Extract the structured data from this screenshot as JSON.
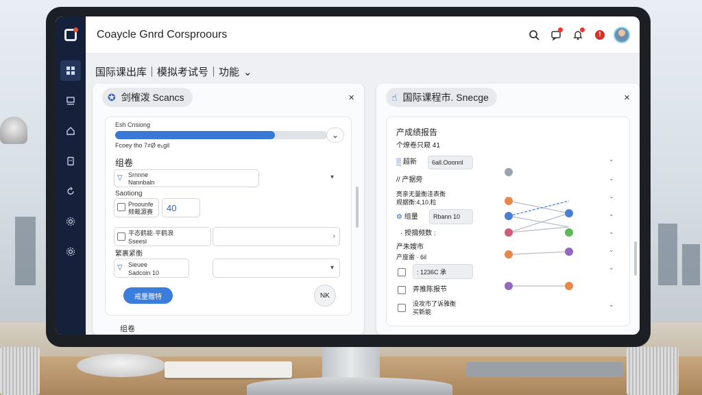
{
  "app": {
    "title": "Coaycle Gnrd Corsproours"
  },
  "breadcrumb": {
    "text": "国际课出库｜模拟考试号｜功能",
    "chevron": "⌄"
  },
  "sidebar_icons": [
    "grid-icon",
    "layers-icon",
    "home-icon",
    "document-icon",
    "refresh-icon",
    "settings-icon",
    "gear-icon"
  ],
  "left_panel": {
    "chip_label": "剑榷泼 Scancs",
    "close": "×",
    "progress": {
      "label": "Esh Cnsiong",
      "sublabel": "Fcoey tho 7≠Ø e₆gil",
      "percent": 75
    },
    "section_title": "组卷",
    "fields": [
      {
        "label_a": "Srnnne",
        "label_b": "Nannbaln"
      },
      {
        "heading": "Saotiong",
        "label_a": "Proounfe",
        "label_b": "频裁源赛",
        "value": "40"
      },
      {
        "label_a": "平态鹤能·平鹤浪",
        "label_b": "Sseesl"
      },
      {
        "heading": "繁裹紧衡",
        "label_a": "Sieuee",
        "label_b": "Sadcoin 10"
      }
    ],
    "primary_button": "戒量赠特",
    "ok_button": "NK",
    "footer": "组卷"
  },
  "right_panel": {
    "chip_label": "国际课程市. Snecge",
    "close": "×",
    "title": "产成绩报告",
    "sub1": "个燎卷只窥 41",
    "row1_label": "超新",
    "row1_value": "6all.Ooonnl",
    "heading2": "// 产据旁",
    "desc2a": "亮亲无量衡洼表衡",
    "desc2b": "规据衡:4,10,粒",
    "row2_label": "组量",
    "row2_value": "Rbann 10",
    "heading3": "· 授揖频数 :",
    "heading4": "产朱嫂市",
    "desc4": "产座雷 · 6il",
    "row3_value": ": 1236C 承",
    "row4_label": "弄推陈报节",
    "row5a": "没攻市了诉雅衡",
    "row5b": "买新能",
    "node_colors": [
      "#9aa4ae",
      "#e8874a",
      "#4b7fd1",
      "#d05a7b",
      "#e8874a",
      "#9468c0"
    ]
  }
}
